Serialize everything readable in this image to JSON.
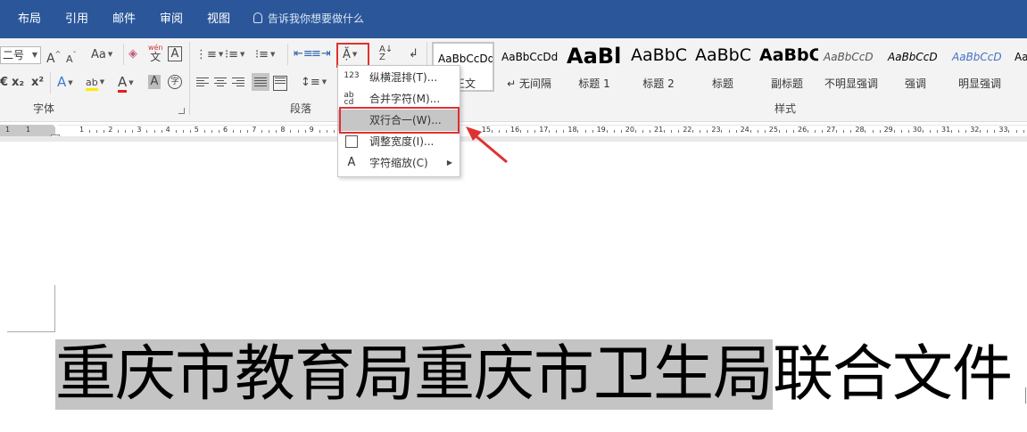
{
  "tabs": [
    "布局",
    "引用",
    "邮件",
    "审阅",
    "视图"
  ],
  "tell_me": "告诉我你想要做什么",
  "font": {
    "size_value": "二号",
    "change_case": "Aa",
    "phonetic_top": "wén",
    "phonetic_bottom": "文",
    "char_border": "A",
    "subscript": "x₂",
    "superscript": "x²",
    "effects": "A",
    "highlight": "ab",
    "font_color": "A",
    "shading": "A",
    "enclose": "字",
    "grow": "A",
    "shrink": "A",
    "group_label": "字体"
  },
  "paragraph": {
    "group_label": "段落"
  },
  "styles": {
    "group_label": "样式",
    "items": [
      {
        "preview": "AaBbCcDd",
        "name": "正文"
      },
      {
        "preview": "AaBbCcDd",
        "name": "↵ 无间隔"
      },
      {
        "preview": "AaBl",
        "name": "标题 1"
      },
      {
        "preview": "AaBbC",
        "name": "标题 2"
      },
      {
        "preview": "AaBbC",
        "name": "标题"
      },
      {
        "preview": "AaBbC",
        "name": "副标题"
      },
      {
        "preview": "AaBbCcD",
        "name": "不明显强调"
      },
      {
        "preview": "AaBbCcD",
        "name": "强调"
      },
      {
        "preview": "AaBbCcD",
        "name": "明显强调"
      },
      {
        "preview": "Aa",
        "name": ""
      }
    ]
  },
  "menu": {
    "items": [
      {
        "label": "纵横混排(T)...",
        "icon": "123"
      },
      {
        "label": "合并字符(M)...",
        "icon": "ab cd"
      },
      {
        "label": "双行合一(W)...",
        "icon": ""
      },
      {
        "label": "调整宽度(I)...",
        "icon": ""
      },
      {
        "label": "字符缩放(C)",
        "icon": "A"
      }
    ]
  },
  "ruler": {
    "left_numbers": [
      "1",
      "1"
    ],
    "numbers": [
      "1",
      "2",
      "3",
      "4",
      "5",
      "6",
      "7",
      "8",
      "9",
      "15",
      "16",
      "17",
      "18",
      "19",
      "20",
      "21",
      "22",
      "23",
      "24",
      "25",
      "26",
      "27",
      "28",
      "29",
      "30",
      "31",
      "32",
      "33"
    ]
  },
  "document": {
    "selected_text": "重庆市教育局重庆市卫生局",
    "rest_text": "联合文件"
  },
  "colors": {
    "tabbar": "#2b579a",
    "highlight_red": "#e0312f",
    "selection_gray": "#c4c4c4"
  }
}
